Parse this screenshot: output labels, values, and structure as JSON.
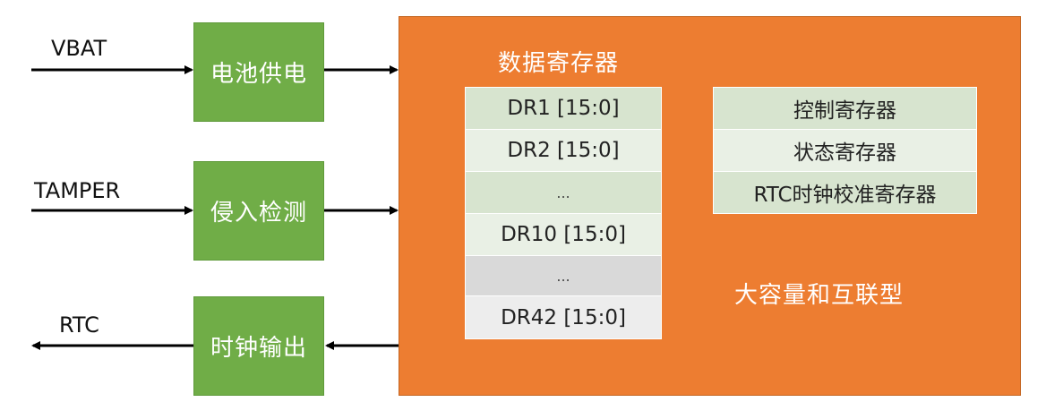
{
  "signals": {
    "vbat": "VBAT",
    "tamper": "TAMPER",
    "rtc": "RTC"
  },
  "blocks": {
    "battery": "电池供电",
    "tamper_detect": "侵入检测",
    "clock_out": "时钟输出"
  },
  "data_registers": {
    "title": "数据寄存器",
    "cells": [
      "DR1 [15:0]",
      "DR2 [15:0]",
      "...",
      "DR10 [15:0]",
      "...",
      "DR42 [15:0]"
    ]
  },
  "control_registers": {
    "cells": [
      "控制寄存器",
      "状态寄存器",
      "RTC时钟校准寄存器"
    ]
  },
  "bracket_label": "大容量和互联型",
  "colors": {
    "block_green": "#70ad47",
    "main_orange": "#ed7d31",
    "cell_green": "#d7e4cf",
    "cell_light_green": "#e9f0e5",
    "cell_gray": "#d9d9d9",
    "cell_light_gray": "#ededed"
  }
}
